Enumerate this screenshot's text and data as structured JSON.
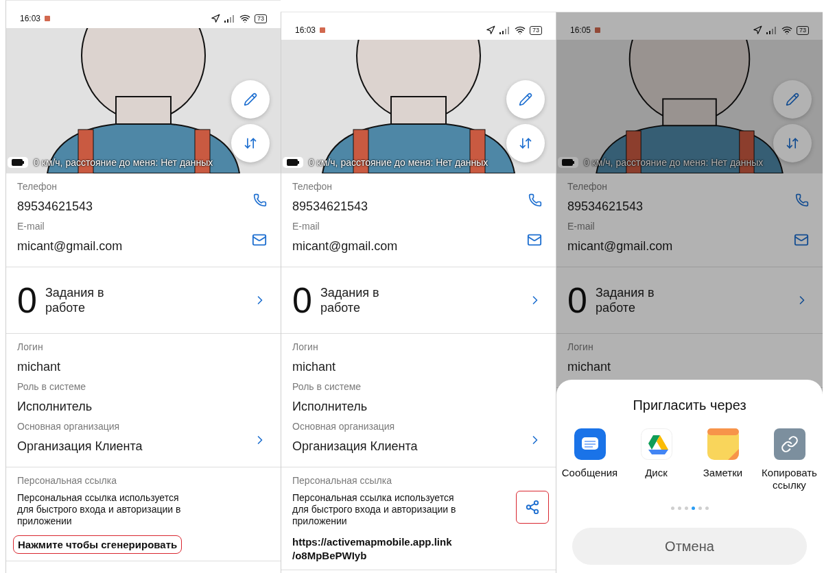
{
  "screens": [
    {
      "status_time": "16:03",
      "battery": "73",
      "dimmed": false,
      "header_caption": "0 км/ч, расстояние до меня: Нет данных",
      "contacts": [
        {
          "kind": "phone",
          "label": "Телефон",
          "value": "89534621543"
        },
        {
          "kind": "email",
          "label": "E-mail",
          "value": "micant@gmail.com"
        }
      ],
      "tasks": {
        "count": "0",
        "label": "Задания в работе"
      },
      "details": [
        {
          "label": "Логин",
          "value": "michant",
          "chevron": false
        },
        {
          "label": "Роль в системе",
          "value": "Исполнитель",
          "chevron": false
        },
        {
          "label": "Основная организация",
          "value": "Организация Клиента",
          "chevron": true
        }
      ],
      "personal_link": {
        "label": "Персональная ссылка",
        "description": "Персональная ссылка используется для быстрого входа и авторизации в приложении",
        "generate_action": {
          "text": "Нажмите чтобы сгенерировать",
          "highlighted": true
        }
      }
    },
    {
      "status_time": "16:03",
      "battery": "73",
      "dimmed": false,
      "header_caption": "0 км/ч, расстояние до меня: Нет данных",
      "contacts": [
        {
          "kind": "phone",
          "label": "Телефон",
          "value": "89534621543"
        },
        {
          "kind": "email",
          "label": "E-mail",
          "value": "micant@gmail.com"
        }
      ],
      "tasks": {
        "count": "0",
        "label": "Задания в работе"
      },
      "details": [
        {
          "label": "Логин",
          "value": "michant",
          "chevron": false
        },
        {
          "label": "Роль в системе",
          "value": "Исполнитель",
          "chevron": false
        },
        {
          "label": "Основная организация",
          "value": "Организация Клиента",
          "chevron": true
        }
      ],
      "personal_link": {
        "label": "Персональная ссылка",
        "description": "Персональная ссылка используется для быстрого входа и авторизации в приложении",
        "url": "https://activemapmobile.app.link\n/o8MpBePWIyb",
        "share": {
          "highlighted": true
        }
      }
    },
    {
      "status_time": "16:05",
      "battery": "73",
      "dimmed": true,
      "header_caption": "0 км/ч, расстояние до меня: Нет данных",
      "contacts": [
        {
          "kind": "phone",
          "label": "Телефон",
          "value": "89534621543"
        },
        {
          "kind": "email",
          "label": "E-mail",
          "value": "micant@gmail.com"
        }
      ],
      "tasks": {
        "count": "0",
        "label": "Задания в работе"
      },
      "details": [
        {
          "label": "Логин",
          "value": "michant",
          "chevron": false
        }
      ],
      "share_sheet": {
        "title": "Пригласить через",
        "apps": [
          {
            "kind": "messages",
            "label": "Сообщения"
          },
          {
            "kind": "drive",
            "label": "Диск"
          },
          {
            "kind": "notes",
            "label": "Заметки"
          },
          {
            "kind": "copy_link",
            "label": "Копировать ссылку"
          }
        ],
        "pages": [
          {
            "selected": false
          },
          {
            "selected": false
          },
          {
            "selected": false
          },
          {
            "selected": true
          },
          {
            "selected": false
          },
          {
            "selected": false
          }
        ],
        "cancel": "Отмена"
      }
    }
  ]
}
